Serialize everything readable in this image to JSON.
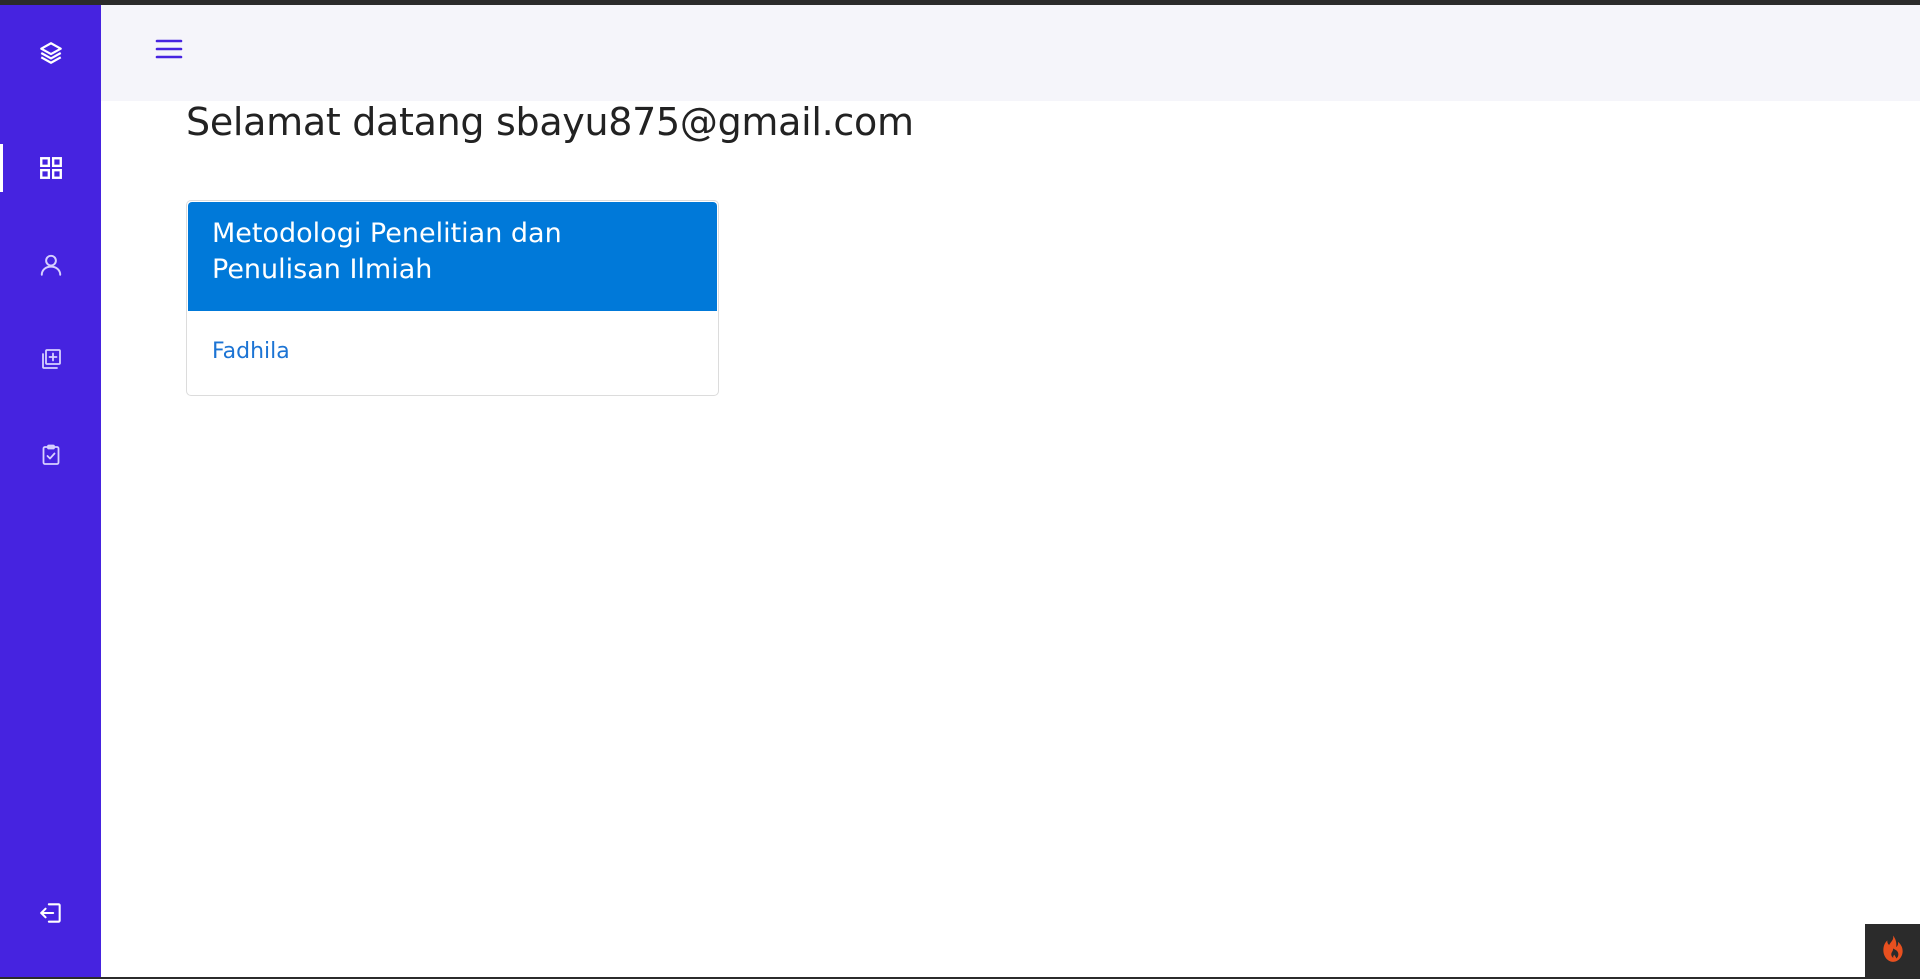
{
  "sidebar": {
    "logo_icon": "layers-icon",
    "items": [
      {
        "id": "dashboard",
        "icon": "grid-icon",
        "active": true
      },
      {
        "id": "profile",
        "icon": "user-icon",
        "active": false
      },
      {
        "id": "add-course",
        "icon": "add-copy-icon",
        "active": false
      },
      {
        "id": "tasks",
        "icon": "clipboard-check-icon",
        "active": false
      }
    ],
    "logout_icon": "logout-icon"
  },
  "topbar": {
    "menu_icon": "hamburger-menu-icon"
  },
  "main": {
    "welcome_text": "Selamat datang sbayu875@gmail.com",
    "courses": [
      {
        "title": "Metodologi Penelitian dan Penulisan Ilmiah",
        "teacher": "Fadhila"
      }
    ]
  },
  "debug_badge": {
    "icon": "flame-icon"
  },
  "colors": {
    "sidebar_bg": "#4623e0",
    "topbar_bg": "#f5f5fa",
    "card_header_bg": "#0079d9",
    "link": "#1c74d4",
    "flame": "#e8501f"
  }
}
